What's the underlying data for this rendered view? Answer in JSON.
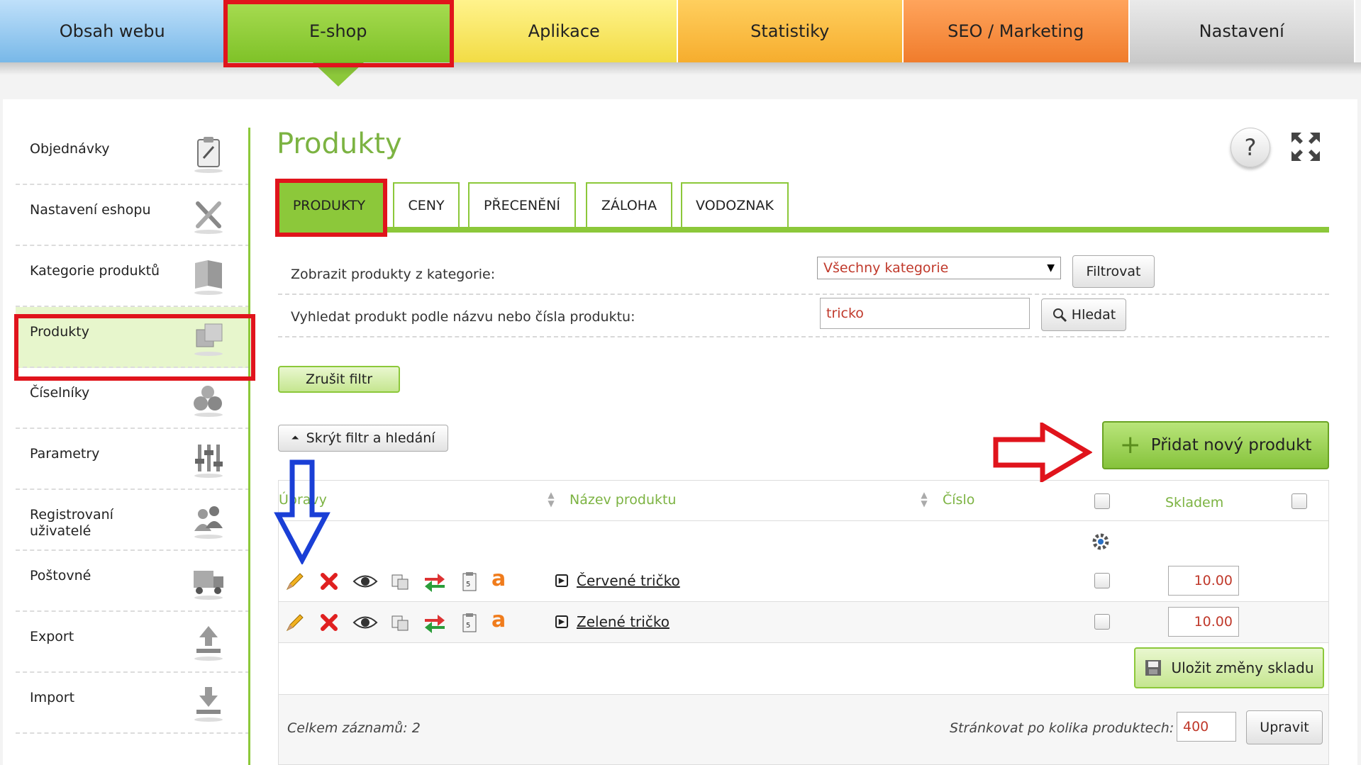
{
  "topnav": {
    "tabs": [
      {
        "label": "Obsah webu"
      },
      {
        "label": "E-shop"
      },
      {
        "label": "Aplikace"
      },
      {
        "label": "Statistiky"
      },
      {
        "label": "SEO / Marketing"
      },
      {
        "label": "Nastavení"
      }
    ],
    "active": "E-shop"
  },
  "sidebar": {
    "items": [
      {
        "label": "Objednávky",
        "icon": "clipboard-icon"
      },
      {
        "label": "Nastavení eshopu",
        "icon": "tools-icon"
      },
      {
        "label": "Kategorie produktů",
        "icon": "book-icon"
      },
      {
        "label": "Produkty",
        "icon": "boxes-icon"
      },
      {
        "label": "Číselníky",
        "icon": "numbers-icon"
      },
      {
        "label": "Parametry",
        "icon": "sliders-icon"
      },
      {
        "label": "Registrovaní uživatelé",
        "icon": "users-icon"
      },
      {
        "label": "Poštovné",
        "icon": "truck-icon"
      },
      {
        "label": "Export",
        "icon": "upload-icon"
      },
      {
        "label": "Import",
        "icon": "download-icon"
      }
    ],
    "active": "Produkty"
  },
  "page": {
    "title": "Produkty",
    "help": "?"
  },
  "tabs": [
    {
      "label": "PRODUKTY"
    },
    {
      "label": "CENY"
    },
    {
      "label": "PŘECENĚNÍ"
    },
    {
      "label": "ZÁLOHA"
    },
    {
      "label": "VODOZNAK"
    }
  ],
  "filter": {
    "category_label": "Zobrazit produkty z kategorie:",
    "category_value": "Všechny kategorie",
    "filter_button": "Filtrovat",
    "search_label": "Vyhledat produkt podle názvu nebo čísla produktu:",
    "search_value": "tricko",
    "search_button": "Hledat",
    "clear_button": "Zrušit filtr",
    "hide_button": "Skrýt filtr a hledání"
  },
  "add_button": "Přidat nový produkt",
  "table": {
    "headers": {
      "edit": "Úpravy",
      "name": "Název produktu",
      "number": "Číslo",
      "stock": "Skladem"
    },
    "rows": [
      {
        "name": "Červené tričko",
        "stock": "10.00"
      },
      {
        "name": "Zelené tričko",
        "stock": "10.00"
      }
    ],
    "save_button": "Uložit změny skladu"
  },
  "footer": {
    "total": "Celkem záznamů: 2",
    "per_page_label": "Stránkovat po kolika produktech:",
    "per_page_value": "400",
    "update_button": "Upravit"
  },
  "colors": {
    "accent_green": "#8cc83a",
    "title_green": "#7cb342",
    "highlight_red": "#e0141c",
    "arrow_blue": "#1a3fd6"
  }
}
